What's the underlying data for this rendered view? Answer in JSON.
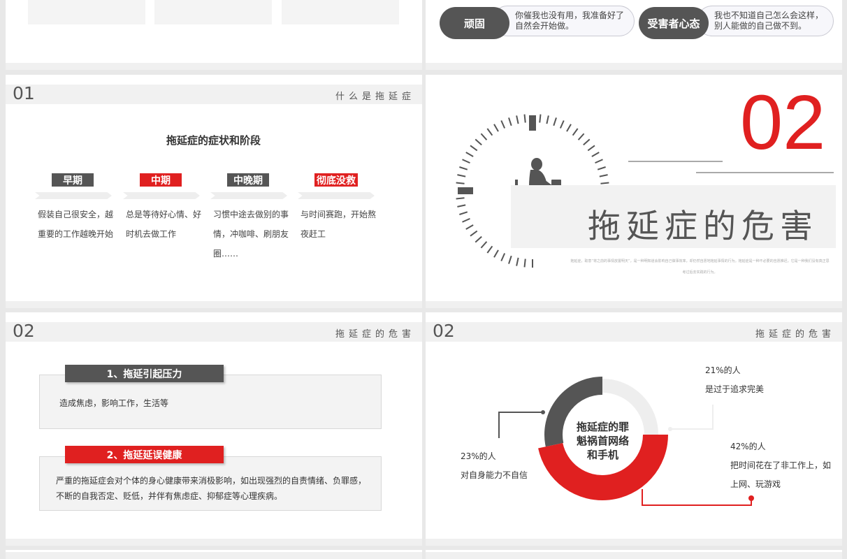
{
  "colors": {
    "red": "#e02020",
    "dark": "#555555",
    "light": "#f1f1f1"
  },
  "mindset": {
    "items": [
      {
        "label": "顽固",
        "text": "你催我也没有用，我准备好了自然会开始做。"
      },
      {
        "label": "受害者心态",
        "text": "我也不知道自己怎么会这样，别人能做的自己做不到。"
      }
    ]
  },
  "slide01": {
    "number": "01",
    "header": "什么是拖延症",
    "title": "拖延症的症状和阶段",
    "stages": [
      {
        "tag": "早期",
        "text": "假装自己很安全，越重要的工作越晚开始",
        "color": "dark"
      },
      {
        "tag": "中期",
        "text": "总是等待好心情、好时机去做工作",
        "color": "red"
      },
      {
        "tag": "中晚期",
        "text": "习惯中途去做别的事情，冲咖啡、刷朋友圈……",
        "color": "dark"
      },
      {
        "tag": "彻底没救",
        "text": "与时间赛跑，开始熬夜赶工",
        "color": "red"
      }
    ]
  },
  "section02": {
    "number": "02",
    "title": "拖延症的危害",
    "description": "拖延症，取意“将之前的事情放置明天”，是一种明知道会影响自己做事效率，却仍然自愿地拖延事情的行为。拖延症是一种不必要的自愿推迟，它是一种我们没有真正思考过后去实践的行为。"
  },
  "slide02a": {
    "number": "02",
    "header": "拖延症的危害",
    "items": [
      {
        "title": "1、拖延引起压力",
        "text": "造成焦虑，影响工作，生活等"
      },
      {
        "title": "2、拖延延误健康",
        "text": "严重的拖延症会对个体的身心健康带来消极影响，如出现强烈的自责情绪、负罪感，不断的自我否定、贬低，并伴有焦虑症、抑郁症等心理疾病。"
      }
    ]
  },
  "slide02b": {
    "number": "02",
    "header": "拖延症的危害",
    "center_text": "拖延症的罪魁祸首网络和手机",
    "center_lines": [
      "拖延症的罪",
      "魁祸首网络",
      "和手机"
    ],
    "callouts": [
      {
        "pct": "21%的人",
        "desc": "是过于追求完美"
      },
      {
        "pct": "23%的人",
        "desc": "对自身能力不自信"
      },
      {
        "pct": "42%的人",
        "desc": "把时间花在了非工作上，如上网、玩游戏"
      }
    ]
  },
  "chart_data": {
    "type": "pie",
    "categories": [
      "是过于追求完美",
      "对自身能力不自信",
      "把时间花在了非工作上，如上网、玩游戏"
    ],
    "values": [
      21,
      23,
      42
    ],
    "colors": [
      "#eeeeee",
      "#555555",
      "#e02020"
    ]
  }
}
